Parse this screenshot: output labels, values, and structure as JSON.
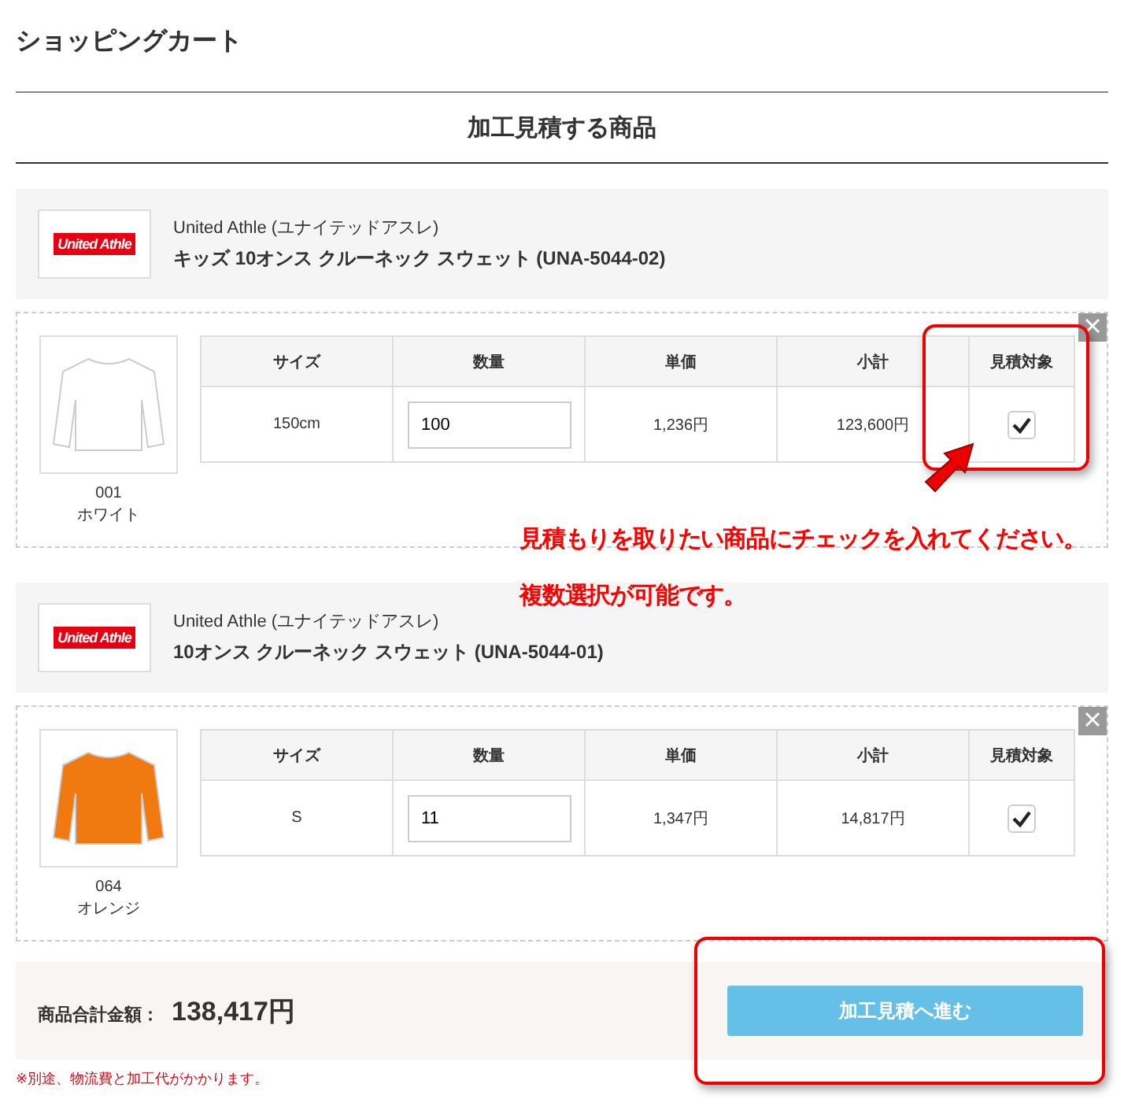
{
  "page_title": "ショッピングカート",
  "section_heading": "加工見積する商品",
  "products": [
    {
      "logo_text": "United Athle",
      "brand": "United Athle (ユナイテッドアスレ)",
      "name": "キッズ 10オンス クルーネック スウェット (UNA-5044-02)",
      "items": [
        {
          "columns": [
            "サイズ",
            "数量",
            "単価",
            "小計",
            "見積対象"
          ],
          "color": "#ffffff",
          "color_code": "001",
          "color_name": "ホワイト",
          "size": "150cm",
          "quantity": "100",
          "unit_price": "1,236円",
          "subtotal": "123,600円",
          "checked": true
        }
      ]
    },
    {
      "logo_text": "United Athle",
      "brand": "United Athle (ユナイテッドアスレ)",
      "name": "10オンス クルーネック スウェット (UNA-5044-01)",
      "items": [
        {
          "columns": [
            "サイズ",
            "数量",
            "単価",
            "小計",
            "見積対象"
          ],
          "color": "#f07a10",
          "color_code": "064",
          "color_name": "オレンジ",
          "size": "S",
          "quantity": "11",
          "unit_price": "1,347円",
          "subtotal": "14,817円",
          "checked": true
        }
      ]
    }
  ],
  "total_label": "商品合計金額：",
  "total": "138,417円",
  "proceed_button": "加工見積へ進む",
  "note": "※別途、物流費と加工代がかかります。",
  "annotation": {
    "lines": [
      "見積もりを取りたい商品にチェックを入れてください。",
      "複数選択が可能です。"
    ]
  }
}
